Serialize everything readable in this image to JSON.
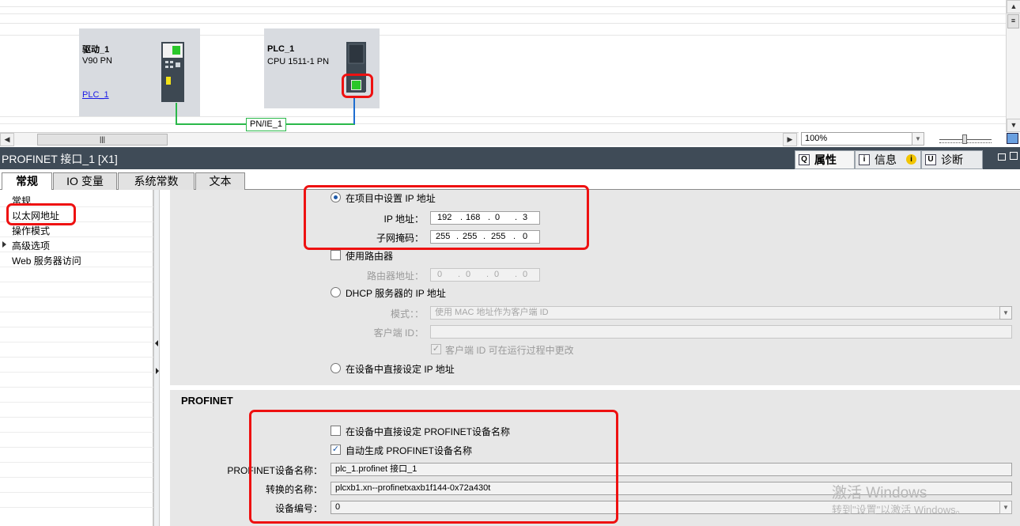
{
  "canvas": {
    "devices": [
      {
        "name": "驱动_1",
        "type": "V90 PN",
        "link": "PLC_1"
      },
      {
        "name": "PLC_1",
        "type": "CPU 1511-1 PN"
      }
    ],
    "network_label": "PN/IE_1",
    "zoom": "100%"
  },
  "panel": {
    "title": "PROFINET 接口_1 [X1]",
    "right_tabs": [
      "属性",
      "信息",
      "诊断"
    ],
    "tabs": [
      "常规",
      "IO 变量",
      "系统常数",
      "文本"
    ],
    "active_tab": "常规"
  },
  "nav": {
    "items": [
      "常规",
      "以太网地址",
      "操作模式",
      "高级选项",
      "Web 服务器访问"
    ],
    "selected": "以太网地址"
  },
  "ip": {
    "set_in_project": "在项目中设置 IP 地址",
    "ip_label": "IP 地址：",
    "ip_octets": [
      "192",
      "168",
      "0",
      "3"
    ],
    "mask_label": "子网掩码：",
    "mask_octets": [
      "255",
      "255",
      "255",
      "0"
    ],
    "use_router": "使用路由器",
    "router_label": "路由器地址：",
    "router_octets": [
      "0",
      "0",
      "0",
      "0"
    ],
    "dhcp": "DHCP 服务器的 IP 地址",
    "mode_label": "模式：：",
    "mode_value": "使用 MAC 地址作为客户端 ID",
    "client_label": "客户端 ID：",
    "client_value": "",
    "client_change": "客户端 ID 可在运行过程中更改",
    "set_in_device": "在设备中直接设定 IP 地址"
  },
  "profinet": {
    "heading": "PROFINET",
    "set_name_in_device": "在设备中直接设定 PROFINET设备名称",
    "auto_generate": "自动生成 PROFINET设备名称",
    "device_name_label": "PROFINET设备名称：",
    "device_name": "plc_1.profinet 接口_1",
    "converted_label": "转换的名称：",
    "converted_name": "plcxb1.xn--profinetxaxb1f144-0x72a430t",
    "device_number_label": "设备编号：",
    "device_number": "0"
  },
  "watermark": {
    "line1": "激活 Windows",
    "line2": "转到\"设置\"以激活 Windows。"
  }
}
